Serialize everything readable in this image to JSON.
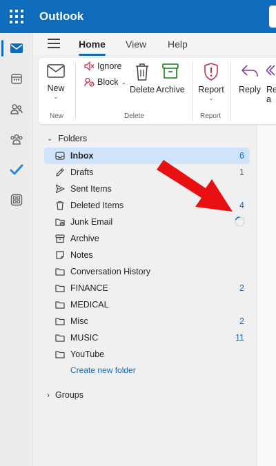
{
  "app": {
    "title": "Outlook"
  },
  "ribbon_tabs": [
    {
      "label": "Home"
    },
    {
      "label": "View"
    },
    {
      "label": "Help"
    }
  ],
  "ribbon": {
    "new": {
      "label": "New",
      "group": "New"
    },
    "ignore": {
      "label": "Ignore"
    },
    "block": {
      "label": "Block"
    },
    "delete": {
      "label": "Delete"
    },
    "archive": {
      "label": "Archive"
    },
    "delete_group": "Delete",
    "report": {
      "label": "Report",
      "group": "Report"
    },
    "reply": {
      "label": "Reply"
    },
    "reply_all_partial": {
      "line1": "Re",
      "line2": "a"
    }
  },
  "folders_header": "Folders",
  "folders": [
    {
      "name": "Inbox",
      "count": "6",
      "icon": "inbox-icon",
      "selected": true
    },
    {
      "name": "Drafts",
      "count": "1",
      "icon": "pencil-icon"
    },
    {
      "name": "Sent Items",
      "count": "",
      "icon": "send-icon"
    },
    {
      "name": "Deleted Items",
      "count": "4",
      "icon": "trash-icon"
    },
    {
      "name": "Junk Email",
      "count": "",
      "icon": "junk-folder-icon"
    },
    {
      "name": "Archive",
      "count": "",
      "icon": "archive-icon"
    },
    {
      "name": "Notes",
      "count": "",
      "icon": "note-icon"
    },
    {
      "name": "Conversation History",
      "count": "",
      "icon": "folder-icon"
    },
    {
      "name": "FINANCE",
      "count": "2",
      "icon": "folder-icon"
    },
    {
      "name": "MEDICAL",
      "count": "",
      "icon": "folder-icon"
    },
    {
      "name": "Misc",
      "count": "2",
      "icon": "folder-icon"
    },
    {
      "name": "MUSIC",
      "count": "11",
      "icon": "folder-icon"
    },
    {
      "name": "YouTube",
      "count": "",
      "icon": "folder-icon"
    }
  ],
  "create_folder": "Create new folder",
  "groups_header": "Groups",
  "colors": {
    "brand": "#0f6cbd",
    "selected": "#cfe4fa",
    "arrow": "#e81010"
  }
}
